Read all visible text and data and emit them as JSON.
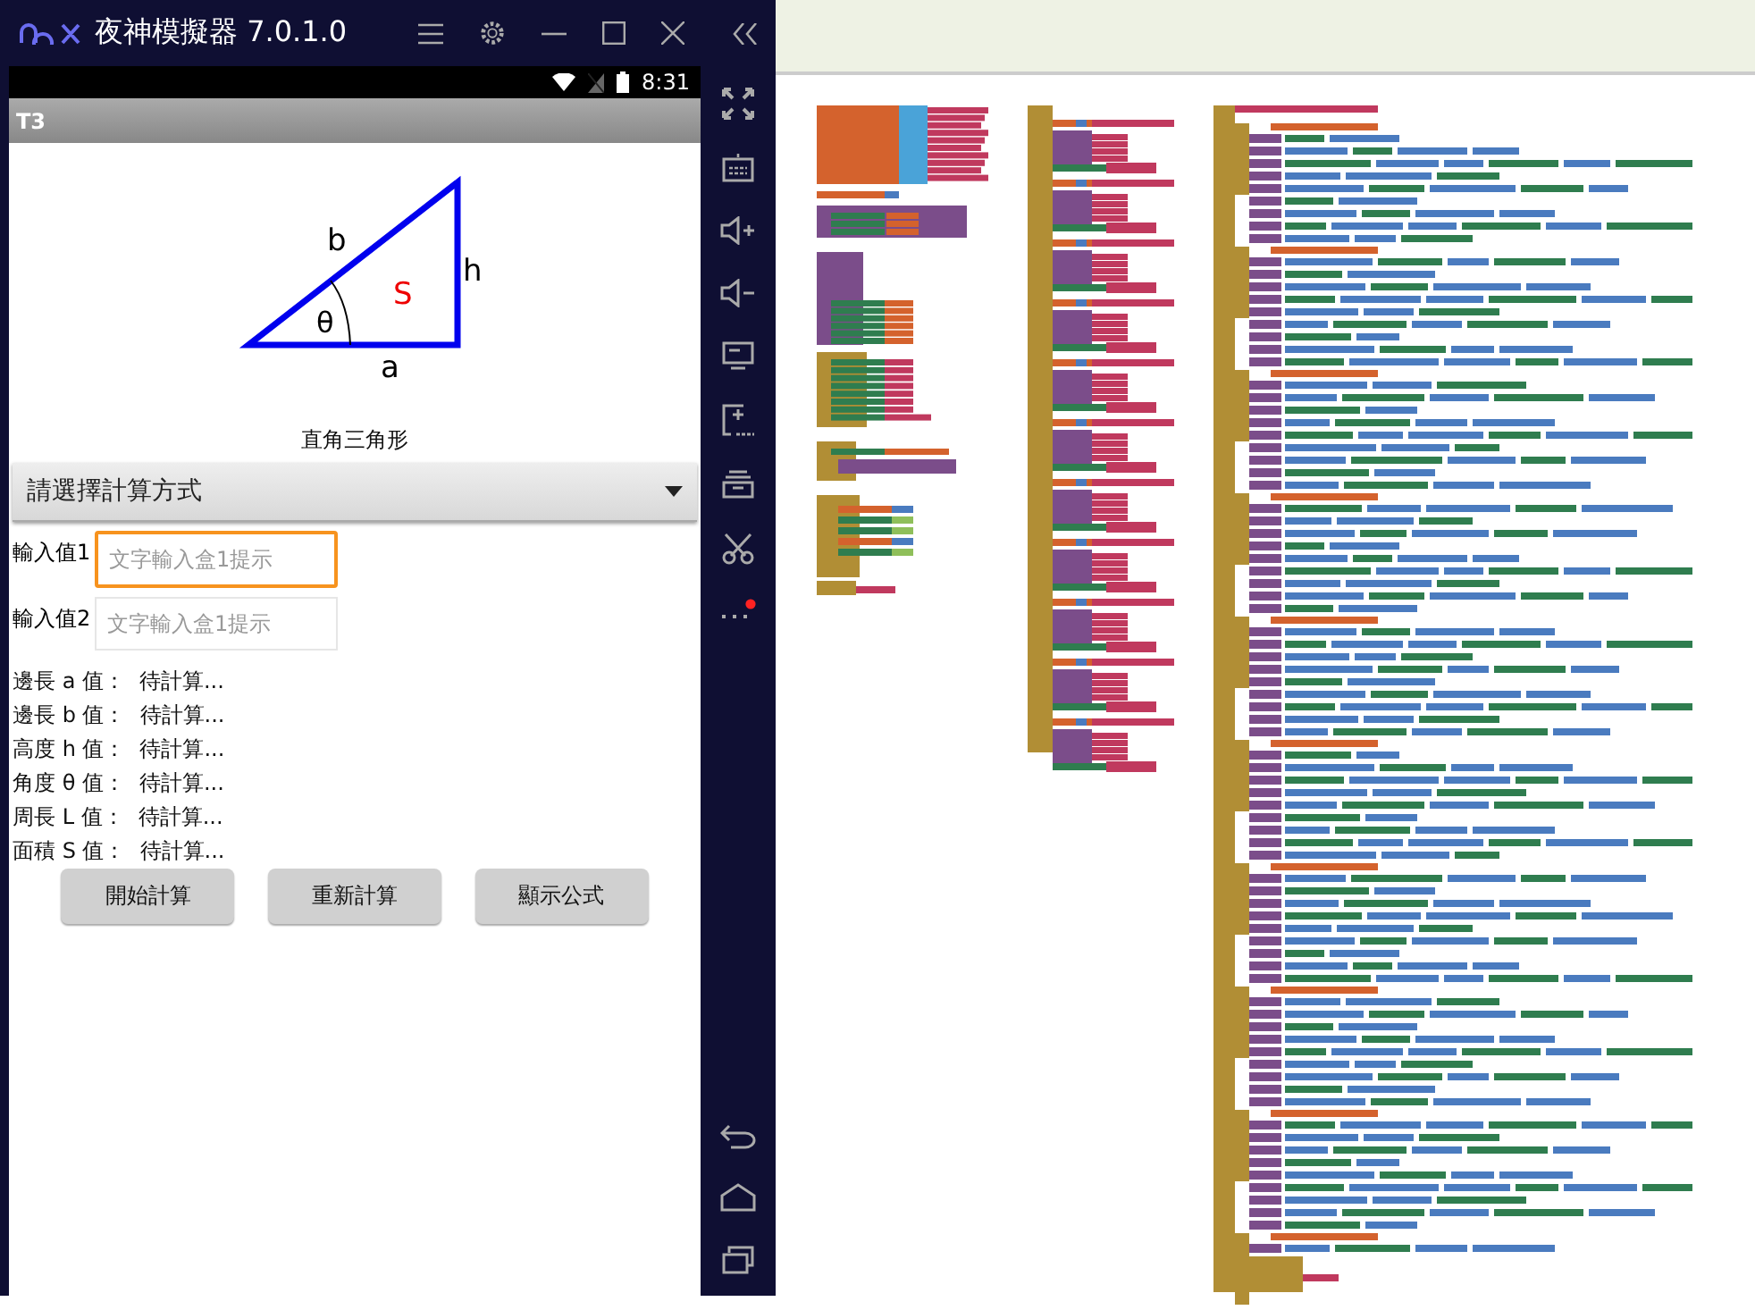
{
  "emulator": {
    "title": "夜神模擬器 7.0.1.0"
  },
  "status_bar": {
    "time": "8:31"
  },
  "app": {
    "title": "T3",
    "diagram": {
      "side_b": "b",
      "side_h": "h",
      "angle": "θ",
      "area": "S",
      "side_a": "a"
    },
    "caption": "直角三角形",
    "spinner": {
      "value": "請選擇計算方式"
    },
    "inputs": [
      {
        "label": "輸入值1",
        "placeholder": "文字輸入盒1提示",
        "focused": true
      },
      {
        "label": "輸入值2",
        "placeholder": "文字輸入盒1提示",
        "focused": false
      }
    ],
    "results": [
      {
        "label": "邊長 a 值：",
        "value": "待計算..."
      },
      {
        "label": "邊長 b 值：",
        "value": "待計算..."
      },
      {
        "label": "高度 h 值：",
        "value": "待計算..."
      },
      {
        "label": "角度 θ 值：",
        "value": "待計算..."
      },
      {
        "label": "周長 L 值：",
        "value": "待計算..."
      },
      {
        "label": "面積 S 值：",
        "value": "待計算..."
      }
    ],
    "buttons": [
      "開始計算",
      "重新計算",
      "顯示公式"
    ]
  }
}
